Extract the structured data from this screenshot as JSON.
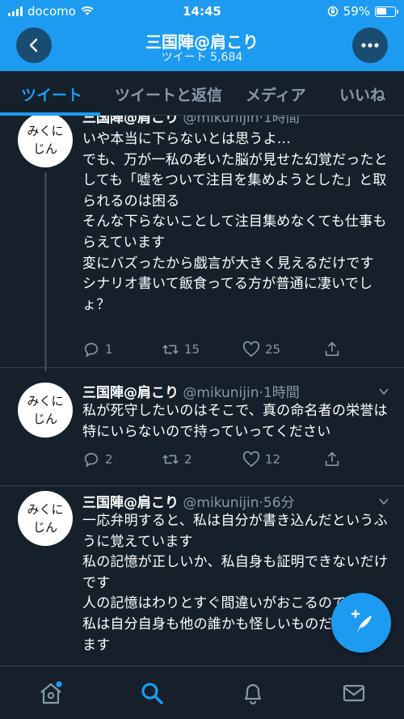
{
  "status_bar": {
    "carrier": "docomo",
    "time": "14:45",
    "battery": "59%",
    "battery_level": 0.59
  },
  "header": {
    "title": "三国陣@肩こり",
    "subtitle": "ツイート 5,684"
  },
  "tabs": [
    {
      "label": "ツイート",
      "active": true
    },
    {
      "label": "ツイートと返信",
      "active": false
    },
    {
      "label": "メディア",
      "active": false
    },
    {
      "label": "いいね",
      "active": false
    }
  ],
  "avatar_text": "みくに\nじん",
  "tweets": [
    {
      "name": "三国陣@肩こり",
      "handle": "@mikunijin",
      "time": "1時間",
      "text": "いや本当に下らないとは思うよ…\nでも、万が一私の老いた脳が見せた幻覚だったとしても「嘘をついて注目を集めようとした」と取られるのは困る\nそんな下らないことして注目集めなくても仕事もらえています\n変にバズったから戯言が大きく見えるだけです\nシナリオ書いて飯食ってる方が普通に凄いでしょ？",
      "replies": "1",
      "retweets": "15",
      "likes": "25"
    },
    {
      "name": "三国陣@肩こり",
      "handle": "@mikunijin",
      "time": "1時間",
      "text": "私が死守したいのはそこで、真の命名者の栄誉は特にいらないので持っていってください",
      "replies": "2",
      "retweets": "2",
      "likes": "12"
    },
    {
      "name": "三国陣@肩こり",
      "handle": "@mikunijin",
      "time": "56分",
      "text": "一応弁明すると、私は自分が書き込んだというふうに覚えています\n私の記憶が正しいか、私自身も証明できないだけです\n人の記憶はわりとすぐ間違いがおこるので、\n私は自分自身も他の誰かも怪しいものだと思ってます",
      "replies": "",
      "retweets": "",
      "likes": ""
    }
  ],
  "bottom_nav": [
    {
      "icon": "home-icon"
    },
    {
      "icon": "search-icon"
    },
    {
      "icon": "bell-icon"
    },
    {
      "icon": "mail-icon"
    }
  ],
  "colors": {
    "accent": "#1d9bf0",
    "background": "#15202b",
    "muted": "#8899a6",
    "divider": "#38444d"
  }
}
